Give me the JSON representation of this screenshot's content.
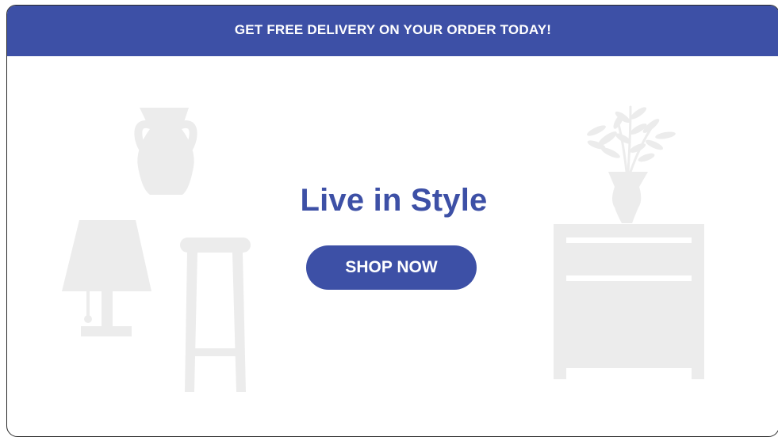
{
  "banner": {
    "promo_text": "GET FREE DELIVERY ON YOUR ORDER TODAY!"
  },
  "hero": {
    "headline": "Live in Style",
    "cta_label": "SHOP NOW"
  },
  "illustrations": [
    "vase-icon",
    "table-lamp-icon",
    "bar-stool-icon",
    "plant-vase-icon",
    "dresser-icon"
  ],
  "colors": {
    "brand": "#3d50a6",
    "illustration": "#ececec",
    "background": "#ffffff"
  }
}
